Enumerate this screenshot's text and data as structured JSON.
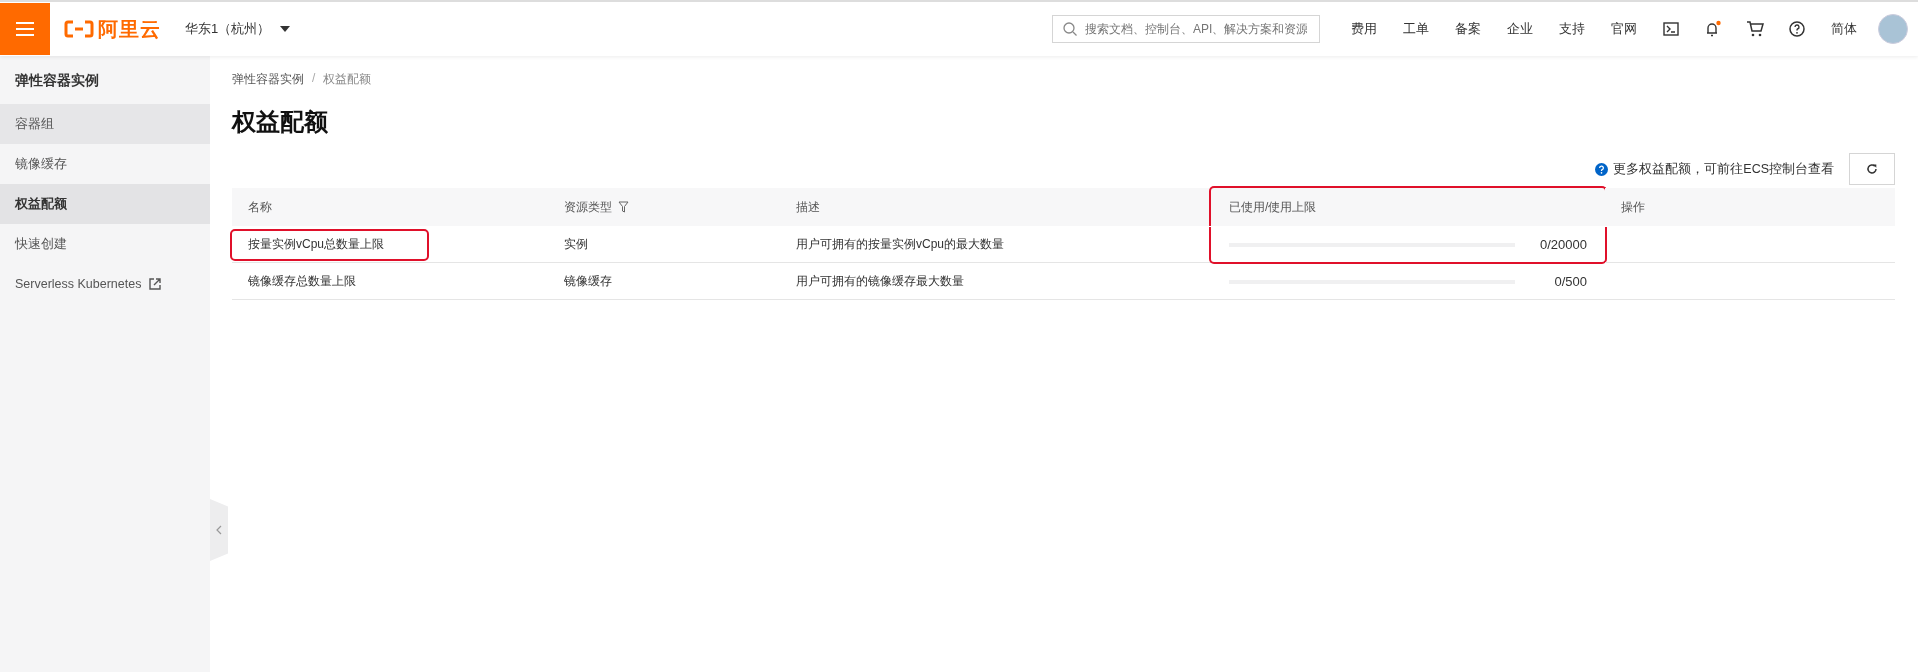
{
  "topbar": {
    "logo": "阿里云",
    "region": "华东1（杭州）",
    "search": {
      "placeholder": "搜索文档、控制台、API、解决方案和资源"
    },
    "nav": [
      "费用",
      "工单",
      "备案",
      "企业",
      "支持",
      "官网"
    ],
    "notification_dot": true,
    "language": "简体"
  },
  "sidebar": {
    "title": "弹性容器实例",
    "items": [
      {
        "label": "容器组",
        "selected": false,
        "hovered": true,
        "external": false
      },
      {
        "label": "镜像缓存",
        "selected": false,
        "hovered": false,
        "external": false
      },
      {
        "label": "权益配额",
        "selected": true,
        "hovered": false,
        "external": false
      },
      {
        "label": "快速创建",
        "selected": false,
        "hovered": false,
        "external": false
      },
      {
        "label": "Serverless Kubernetes",
        "selected": false,
        "hovered": false,
        "external": true
      }
    ]
  },
  "breadcrumb": [
    "弹性容器实例",
    "权益配额"
  ],
  "breadcrumb_separator": "/",
  "page_title": "权益配额",
  "toolbar": {
    "hint": "更多权益配额，可前往ECS控制台查看"
  },
  "table": {
    "columns": [
      {
        "label": "名称",
        "filter": false,
        "highlighted": false
      },
      {
        "label": "资源类型",
        "filter": true,
        "highlighted": false
      },
      {
        "label": "描述",
        "filter": false,
        "highlighted": false
      },
      {
        "label": "已使用/使用上限",
        "filter": false,
        "highlighted": true
      },
      {
        "label": "操作",
        "filter": false,
        "highlighted": false
      }
    ],
    "rows": [
      {
        "name": "按量实例vCpu总数量上限",
        "name_highlighted": true,
        "type": "实例",
        "description": "用户可拥有的按量实例vCpu的最大数量",
        "level": 0,
        "usage": "0/20000",
        "usage_highlighted": true
      },
      {
        "name": "镜像缓存总数量上限",
        "name_highlighted": false,
        "type": "镜像缓存",
        "description": "用户可拥有的镜像缓存最大数量",
        "level": 0,
        "usage": "0/500",
        "usage_highlighted": false
      }
    ]
  }
}
